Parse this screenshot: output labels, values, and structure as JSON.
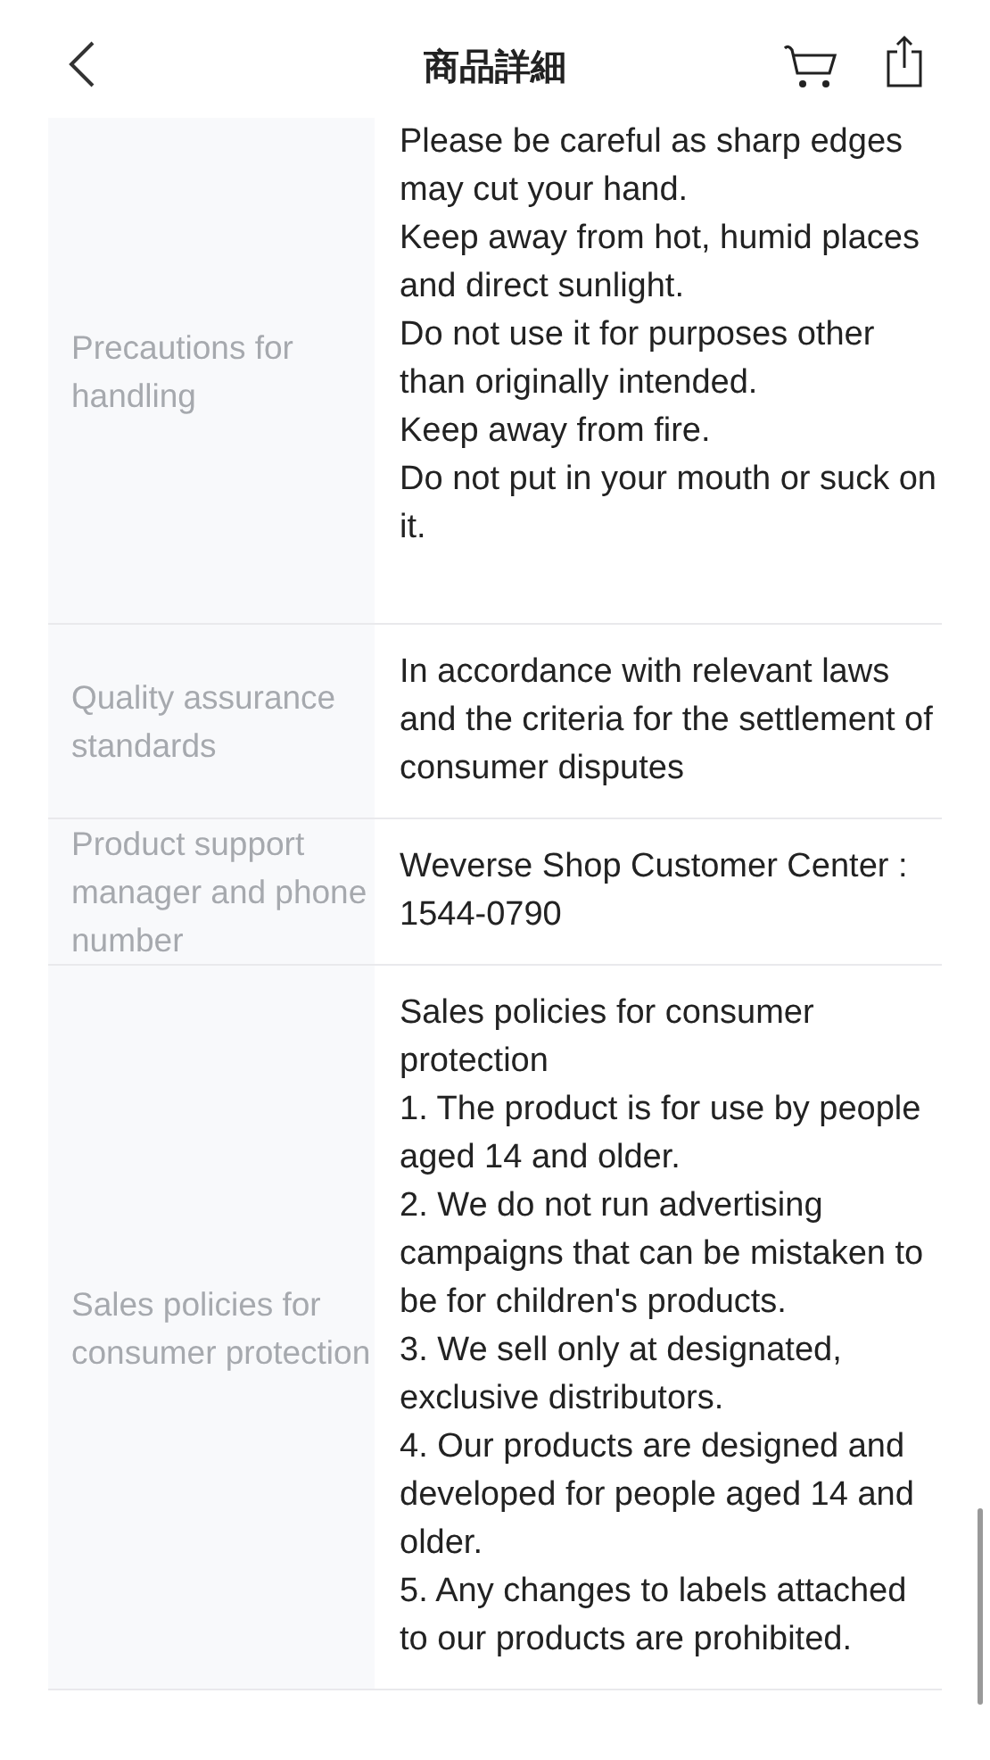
{
  "header": {
    "title": "商品詳細"
  },
  "rows": [
    {
      "label": "Precautions for handling",
      "paragraphs": [
        "Please be careful as sharp edges may cut your hand.",
        "Keep away from hot, humid places and direct sunlight.",
        "Do not use it for purposes other than originally intended.",
        "Keep away from fire.",
        "Do not put in your mouth or suck on it."
      ]
    },
    {
      "label": "Quality assurance standards",
      "paragraphs": [
        "In accordance with relevant laws and the criteria for the settlement of consumer disputes"
      ]
    },
    {
      "label": "Product support manager and phone number",
      "paragraphs": [
        "Weverse Shop Customer Center : 1544-0790"
      ]
    },
    {
      "label": "Sales policies for consumer protection",
      "paragraphs": [
        "Sales policies for consumer protection",
        "1. The product is for use by people aged 14 and older.",
        "2. We do not run advertising campaigns that can be mistaken to be for children's products.",
        "3. We sell only at designated, exclusive distributors.",
        "4. Our products are designed and developed for people aged 14 and older.",
        "5. Any changes to labels attached to our products are prohibited."
      ]
    }
  ]
}
